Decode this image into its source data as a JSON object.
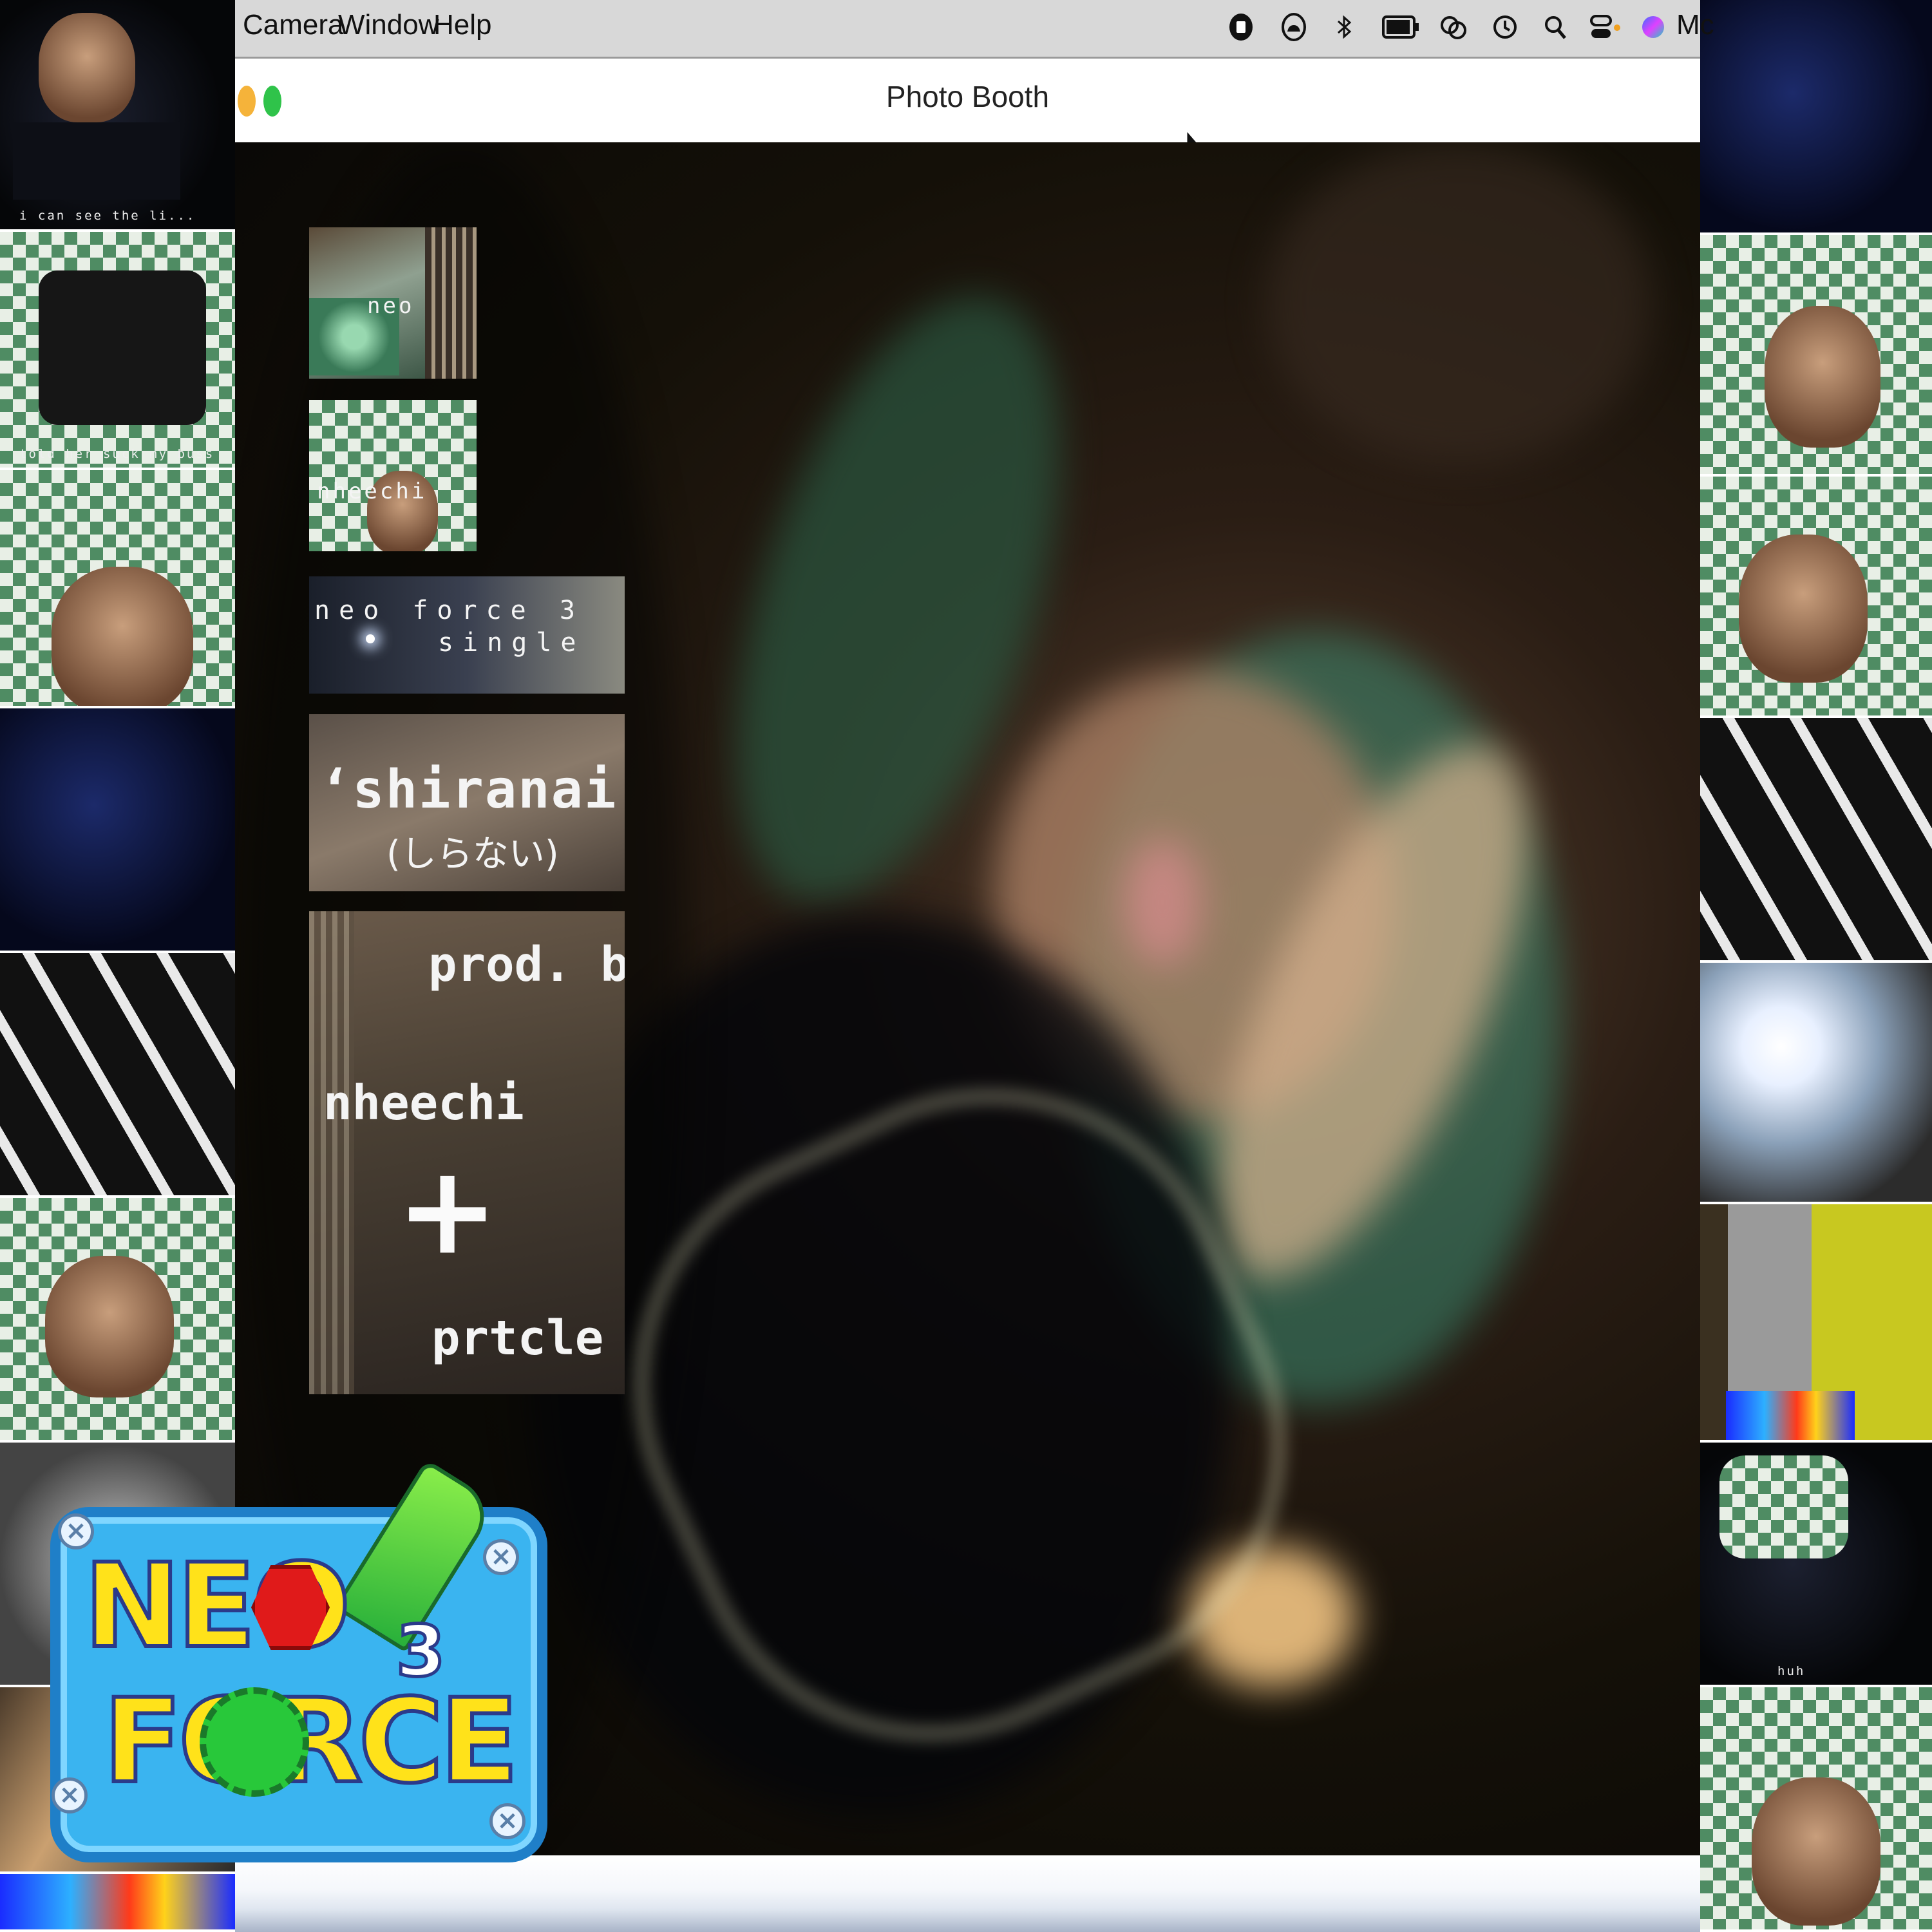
{
  "menubar": {
    "items": [
      "Camera",
      "Window",
      "Help"
    ],
    "status_icons": [
      "record-icon",
      "cloud-icon",
      "bluetooth-icon",
      "battery-icon",
      "screen-mirror-icon",
      "time-machine-icon",
      "search-icon",
      "control-center-icon",
      "siri-icon"
    ],
    "clock_text": "Mc"
  },
  "window": {
    "title": "Photo Booth",
    "traffic_colors": [
      "#f5b33a",
      "#2fc34a"
    ]
  },
  "left_strip": {
    "captions": [
      "i can see the li...",
      "told her suck my buss"
    ]
  },
  "right_strip": {
    "captions": [
      "huh"
    ]
  },
  "overlay": {
    "card1_text": "neo",
    "card2_text": "nheechi",
    "card3_line1": "neo force 3",
    "card3_line2": "single",
    "card4_title": "‘shiranai’",
    "card4_sub": "(しらない)",
    "card5_prod": "prod. by",
    "card5_name1": "nheechi",
    "card5_plus": "+",
    "card5_name2": "prtcle"
  },
  "logo": {
    "word1": "NEO",
    "word2": "FORCE",
    "number": "3",
    "colors": {
      "frame": "#3ab4f0",
      "text": "#ffe21a",
      "hex": "#e01a1a",
      "gear": "#28c83a"
    }
  }
}
